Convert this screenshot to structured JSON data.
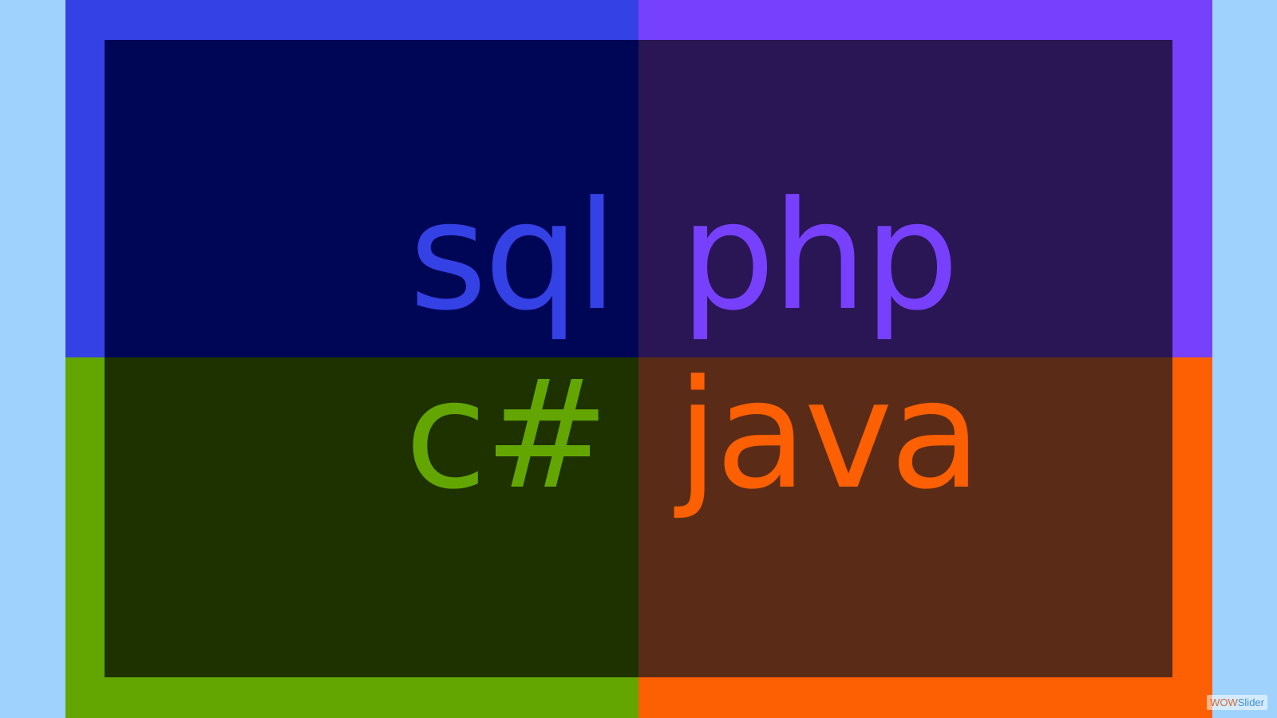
{
  "colors": {
    "page_background": "#9fd3fe",
    "blue_frame": "#3441e4",
    "blue_fill": "#000656",
    "purple_frame": "#7740fd",
    "purple_fill": "#2a1555",
    "green_frame": "#63a602",
    "green_fill": "#1e3200",
    "orange_frame": "#fd5f03",
    "orange_fill": "#5a2c17"
  },
  "quadrants": [
    {
      "id": "top-left",
      "label": "sql"
    },
    {
      "id": "top-right",
      "label": "php"
    },
    {
      "id": "bottom-left",
      "label": "c#"
    },
    {
      "id": "bottom-right",
      "label": "java"
    }
  ],
  "watermark": {
    "part1": "WOW",
    "part2": "Slider"
  }
}
